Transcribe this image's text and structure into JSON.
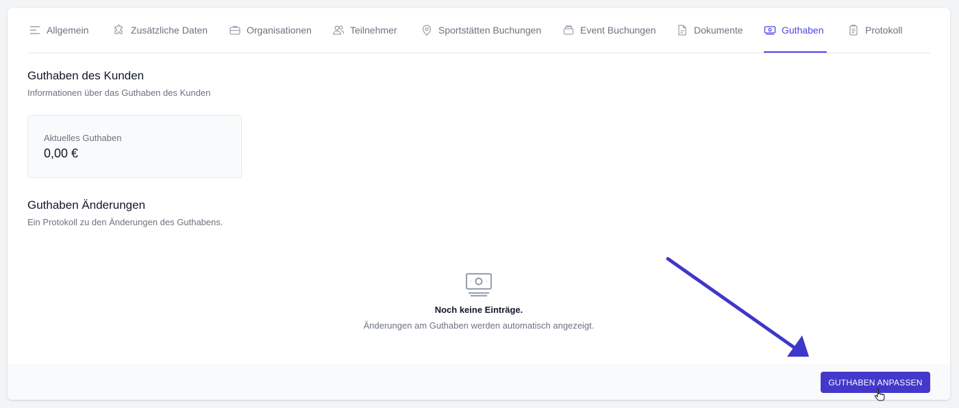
{
  "tabs": [
    {
      "label": "Allgemein",
      "icon": "menu-lines-icon"
    },
    {
      "label": "Zusätzliche Daten",
      "icon": "puzzle-icon"
    },
    {
      "label": "Organisationen",
      "icon": "briefcase-icon"
    },
    {
      "label": "Teilnehmer",
      "icon": "users-icon"
    },
    {
      "label": "Sportstätten Buchungen",
      "icon": "location-pin-icon"
    },
    {
      "label": "Event Buchungen",
      "icon": "inbox-stack-icon"
    },
    {
      "label": "Dokumente",
      "icon": "document-icon"
    },
    {
      "label": "Guthaben",
      "icon": "cash-icon"
    },
    {
      "label": "Protokoll",
      "icon": "clipboard-icon"
    }
  ],
  "active_tab": "Guthaben",
  "accent_color": "#4f46e5",
  "balance_section": {
    "title": "Guthaben des Kunden",
    "subtitle": "Informationen über das Guthaben des Kunden",
    "current_label": "Aktuelles Guthaben",
    "current_value": "0,00 €"
  },
  "changes_section": {
    "title": "Guthaben Änderungen",
    "subtitle": "Ein Protokoll zu den Änderungen des Guthabens.",
    "empty_icon": "cash-icon",
    "empty_title": "Noch keine Einträge.",
    "empty_subtitle": "Änderungen am Guthaben werden automatisch angezeigt."
  },
  "footer": {
    "adjust_button": "GUTHABEN ANPASSEN",
    "button_color": "#4338ca"
  },
  "annotation": {
    "type": "arrow",
    "color": "#3f37c9",
    "points_to": "adjust_button"
  }
}
